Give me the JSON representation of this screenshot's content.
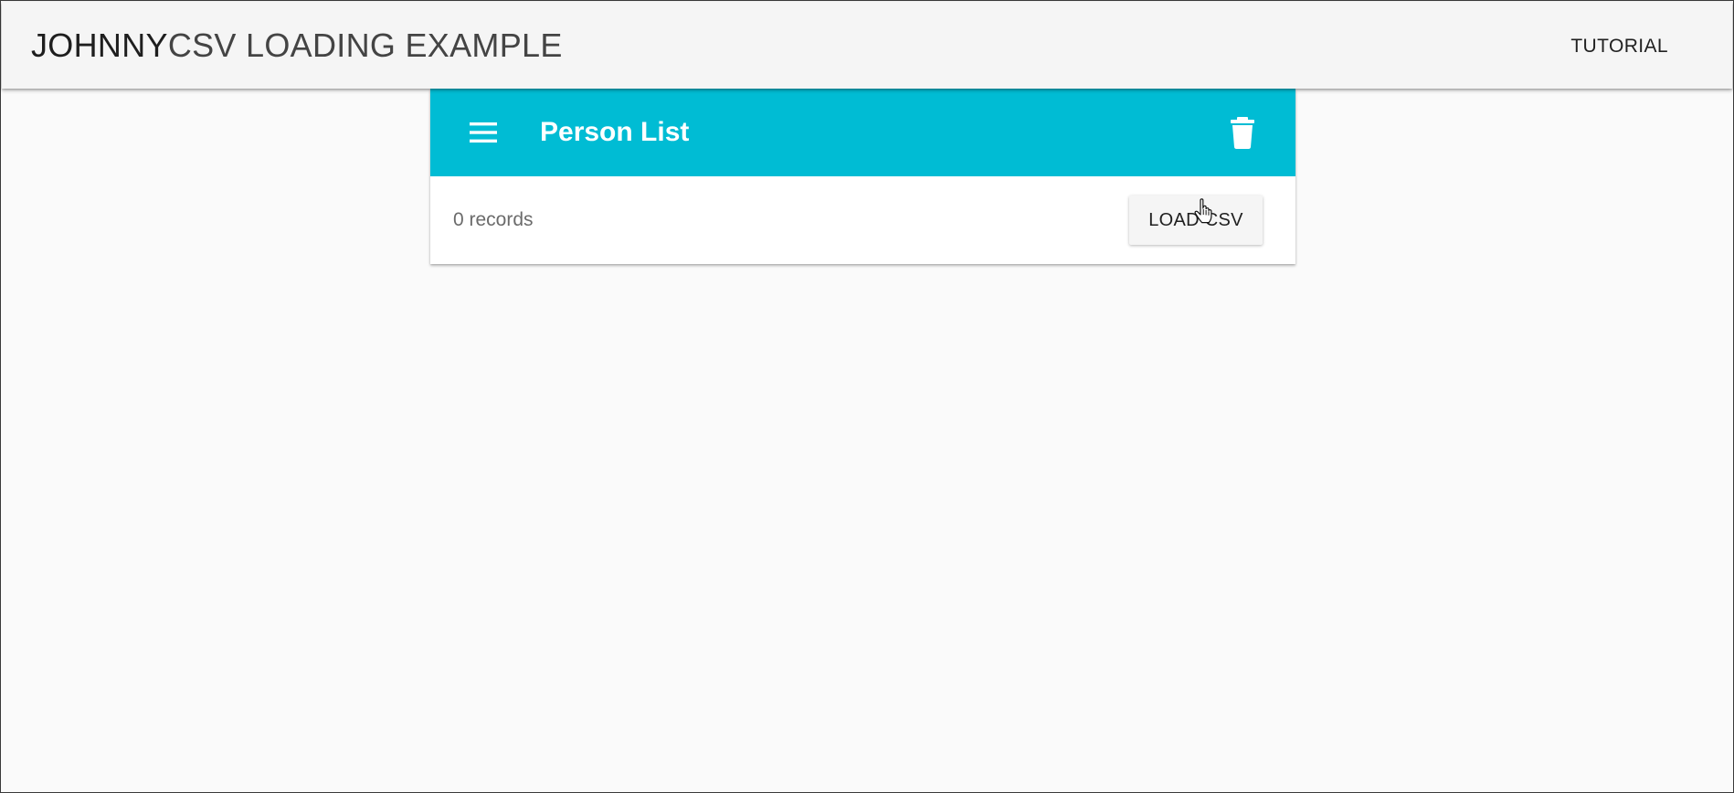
{
  "app_bar": {
    "title_strong": "JOHNNY",
    "title_light": "CSV LOADING EXAMPLE",
    "nav_link": "TUTORIAL",
    "background": "#f5f5f5"
  },
  "card": {
    "title": "Person List",
    "accent": "#00bcd4",
    "menu_icon": "menu-icon",
    "delete_icon": "trash-icon",
    "records_text": "0 records",
    "load_button": "LOAD CSV"
  },
  "cursor": {
    "icon": "hand-pointer-icon"
  }
}
